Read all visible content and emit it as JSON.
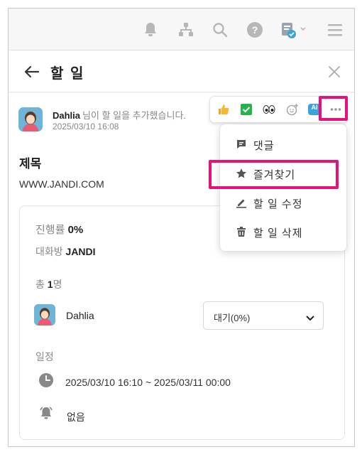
{
  "header": {
    "title": "할 일"
  },
  "task": {
    "author": "Dahlia",
    "author_suffix": "님이 할 일을 추가했습니다.",
    "timestamp": "2025/03/10 16:08",
    "title": "제목",
    "url": "WWW.JANDI.COM"
  },
  "details": {
    "progress_label": "진행률",
    "progress_value": "0%",
    "room_label": "대화방",
    "room_value": "JANDI",
    "total_prefix": "총",
    "total_count": "1",
    "total_suffix": "명",
    "member_name": "Dahlia",
    "status_selected": "대기(0%)",
    "schedule_label": "일정",
    "schedule_range": "2025/03/10 16:10  ~  2025/03/11 00:00",
    "alarm_value": "없음"
  },
  "actions": {
    "ai_label": "AI"
  },
  "menu": {
    "items": [
      {
        "label": "댓글",
        "icon": "comment-icon"
      },
      {
        "label": "즐겨찾기",
        "icon": "star-icon"
      },
      {
        "label": "할 일 수정",
        "icon": "edit-icon"
      },
      {
        "label": "할 일 삭제",
        "icon": "trash-icon"
      }
    ]
  },
  "colors": {
    "highlight": "#e3137a",
    "accent_blue": "#3aa3d8",
    "icon_gray": "#b7b7b7"
  }
}
